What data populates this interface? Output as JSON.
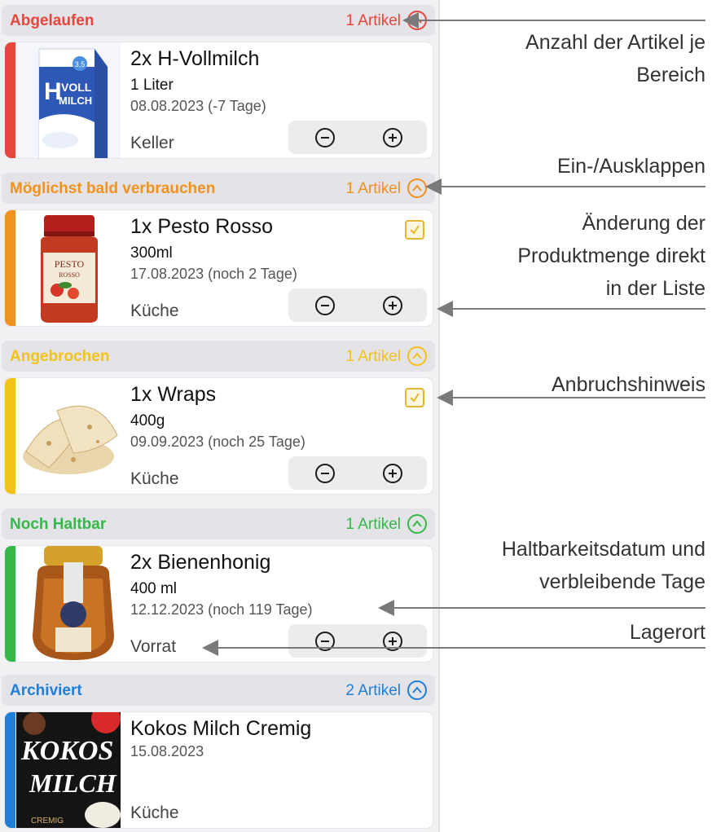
{
  "sections": [
    {
      "title": "Abgelaufen",
      "count": "1 Artikel",
      "color": "#e8453c",
      "items": [
        {
          "name": "2x H-Vollmilch",
          "size": "1 Liter",
          "date": "08.08.2023 (-7 Tage)",
          "location": "Keller",
          "opened": false,
          "stepper": true,
          "image": "milk-carton"
        }
      ]
    },
    {
      "title": "Möglichst bald verbrauchen",
      "count": "1 Artikel",
      "color": "#f0921e",
      "items": [
        {
          "name": "1x Pesto Rosso",
          "size": "300ml",
          "date": "17.08.2023 (noch 2 Tage)",
          "location": "Küche",
          "opened": true,
          "stepper": true,
          "image": "pesto-jar"
        }
      ]
    },
    {
      "title": "Angebrochen",
      "count": "1 Artikel",
      "color": "#f2c318",
      "items": [
        {
          "name": "1x Wraps",
          "size": "400g",
          "date": "09.09.2023 (noch 25 Tage)",
          "location": "Küche",
          "opened": true,
          "stepper": true,
          "image": "tortilla-wraps"
        }
      ]
    },
    {
      "title": "Noch Haltbar",
      "count": "1 Artikel",
      "color": "#34b84a",
      "items": [
        {
          "name": "2x Bienenhonig",
          "size": "400 ml",
          "date": "12.12.2023 (noch 119 Tage)",
          "location": "Vorrat",
          "opened": false,
          "stepper": true,
          "image": "honey-jar"
        }
      ]
    },
    {
      "title": "Archiviert",
      "count": "2 Artikel",
      "color": "#1f7fd8",
      "items": [
        {
          "name": "Kokos Milch Cremig",
          "size": "",
          "date": "15.08.2023",
          "location": "Küche",
          "opened": false,
          "stepper": false,
          "image": "coconut-milk-can"
        }
      ]
    }
  ],
  "image_text": {
    "milk": [
      "VOLL",
      "MILCH",
      "3,5"
    ],
    "pesto": [
      "PESTO",
      "ROSSO"
    ],
    "coconut": [
      "KOKOS",
      "MILCH",
      "CREMIG"
    ]
  },
  "annotations": [
    {
      "lines": [
        "Anzahl der Artikel je",
        "Bereich"
      ]
    },
    {
      "lines": [
        "Ein-/Ausklappen"
      ]
    },
    {
      "lines": [
        "Änderung der",
        "Produktmenge direkt",
        "in der Liste"
      ]
    },
    {
      "lines": [
        "Anbruchshinweis"
      ]
    },
    {
      "lines": [
        "Haltbarkeitsdatum und",
        "verbleibende Tage"
      ]
    },
    {
      "lines": [
        "Lagerort"
      ]
    }
  ],
  "icons": {
    "minus": "minus-circle-icon",
    "plus": "plus-circle-icon",
    "toggle": "chevron-up-circle-icon",
    "checkbox": "checkbox-checked-icon"
  }
}
